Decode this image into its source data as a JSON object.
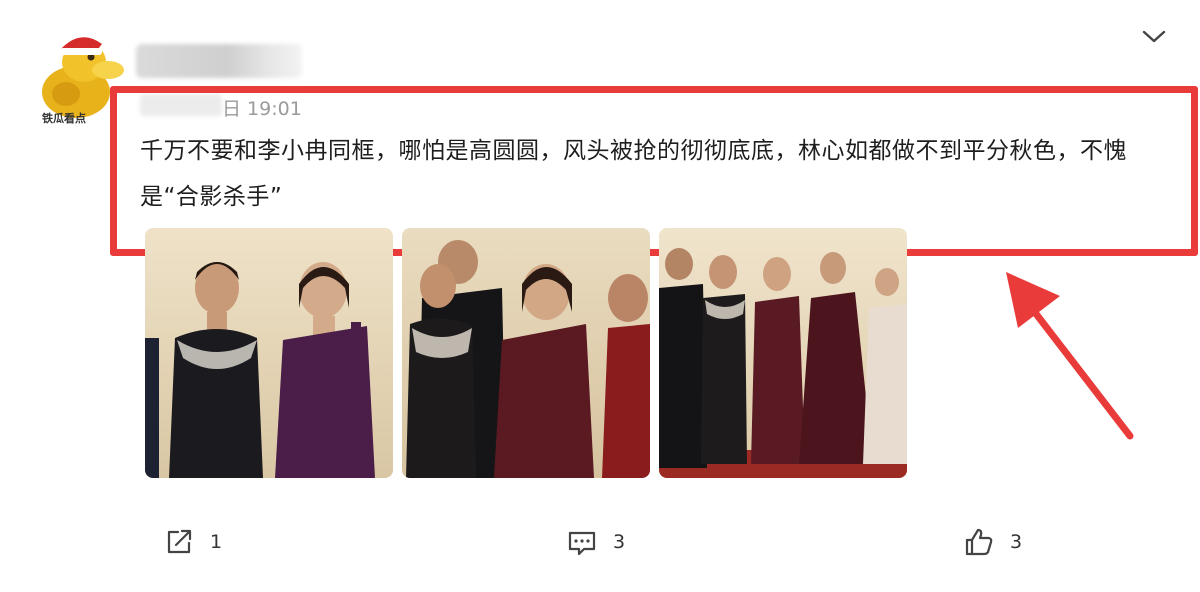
{
  "post": {
    "time_suffix": "日 19:01",
    "text": "千万不要和李小冉同框，哪怕是高圆圆，风头被抢的彻彻底底，林心如都做不到平分秋色，不愧是“合影杀手”",
    "avatar_caption": "铁瓜看点"
  },
  "actions": {
    "share_count": "1",
    "comment_count": "3",
    "like_count": "3"
  },
  "colors": {
    "highlight": "#ea3b3b",
    "text": "#1e1e1e",
    "muted": "#9a9a9a"
  },
  "icons": [
    "duck-avatar",
    "chevron-down-icon",
    "share-icon",
    "comment-icon",
    "thumbs-up-icon",
    "red-arrow"
  ]
}
